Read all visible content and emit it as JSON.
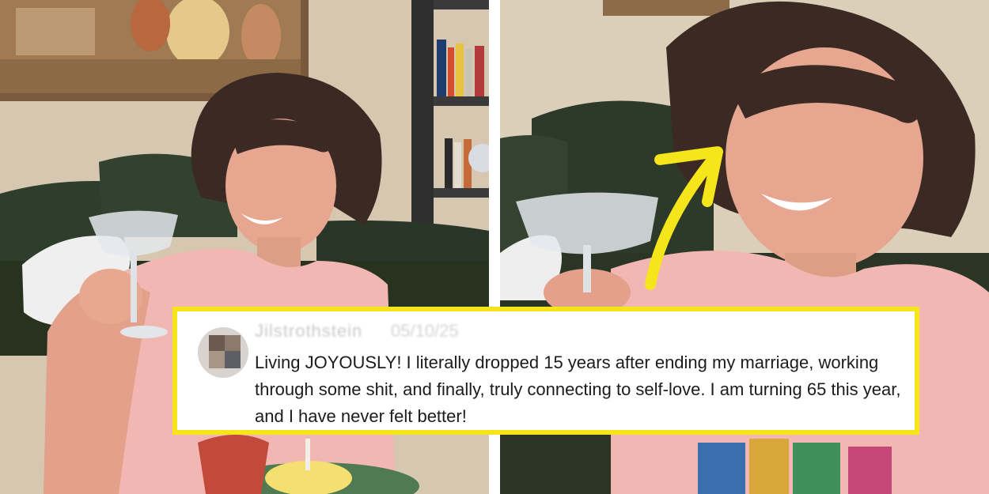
{
  "comment": {
    "username": "Jilstrothstein",
    "date": "05/10/25",
    "text": "Living JOYOUSLY! I literally dropped 15 years after ending my marriage, working through some shit, and finally, truly connecting to self-love. I am turning 65 this year, and I have never felt better!"
  },
  "colors": {
    "highlight_border": "#f5e51a",
    "arrow": "#f5e51a",
    "shirt_pink": "#f2b6b2",
    "sofa_green": "#2c3a2a",
    "wall": "#d9cbb5"
  }
}
